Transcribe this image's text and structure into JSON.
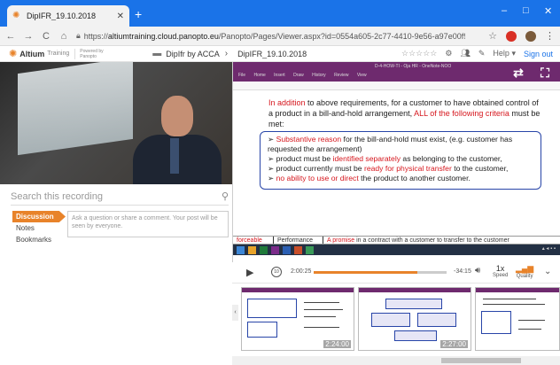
{
  "browser": {
    "tab_title": "DipIFR_19.10.2018",
    "new_tab": "+",
    "url_prefix": "https://",
    "url_host": "altiumtraining.cloud.panopto.eu",
    "url_path": "/Panopto/Pages/Viewer.aspx?id=0554a605-2c77-4410-9e56-a97e00f96db7",
    "minimize": "–",
    "maximize": "□",
    "close": "✕"
  },
  "header": {
    "logo": "Altium",
    "logo_sub": "Training",
    "powered_by": "Powered by Panopto",
    "crumb_folder": "DipIfr by ACCA",
    "crumb_session": "DipIFR_19.10.2018",
    "help": "Help",
    "sign_out": "Sign out"
  },
  "left": {
    "search_placeholder": "Search this recording",
    "tabs": [
      {
        "label": "Discussion"
      },
      {
        "label": "Notes"
      },
      {
        "label": "Bookmarks"
      }
    ],
    "comment_placeholder": "Ask a question or share a comment. Your post will be seen by everyone."
  },
  "slide": {
    "ribbon_title": "D-4-HOW-TI - Oja HR - OneNote-NOO",
    "ribbon_menu": "File Home Insert Draw History Review View",
    "intro_a": "In addition",
    "intro_b": " to above requirements, for a customer to have obtained control of a product in a bill-and-hold arrangement, ",
    "intro_c": "ALL of the following criteria",
    "intro_d": " must be met:",
    "bullets": [
      {
        "lead": "Substantive reason",
        "rest": " for the bill-and-hold must exist, (e.g. customer has requested the arrangement)"
      },
      {
        "lead": "",
        "rest": "product must be ",
        "hl": "identified separately",
        "tail": " as belonging to the customer,"
      },
      {
        "lead": "",
        "rest": "product currently must be ",
        "hl": "ready for physical transfer",
        "tail": " to the customer,"
      },
      {
        "lead": "no ability to use or direct",
        "rest": " the product to another  customer."
      }
    ],
    "bottom_a": "forceable",
    "bottom_b": "Performance",
    "bottom_c": "A promise",
    "bottom_d": " in a contract with a customer to transfer to the customer"
  },
  "player": {
    "rewind_label": "10",
    "current_time": "2:00:25",
    "remaining_time": "-34:15",
    "progress": 0.78,
    "speed_value": "1x",
    "speed_label": "Speed",
    "quality_label": "Quality"
  },
  "thumbnails": [
    {
      "time": "2:24:00"
    },
    {
      "time": "2:27:00"
    },
    {
      "time": ""
    }
  ],
  "colors": {
    "accent": "#e8832a",
    "browser_blue": "#1a73e8",
    "onenote_purple": "#6e2a6e",
    "slide_red": "#d6171e"
  }
}
